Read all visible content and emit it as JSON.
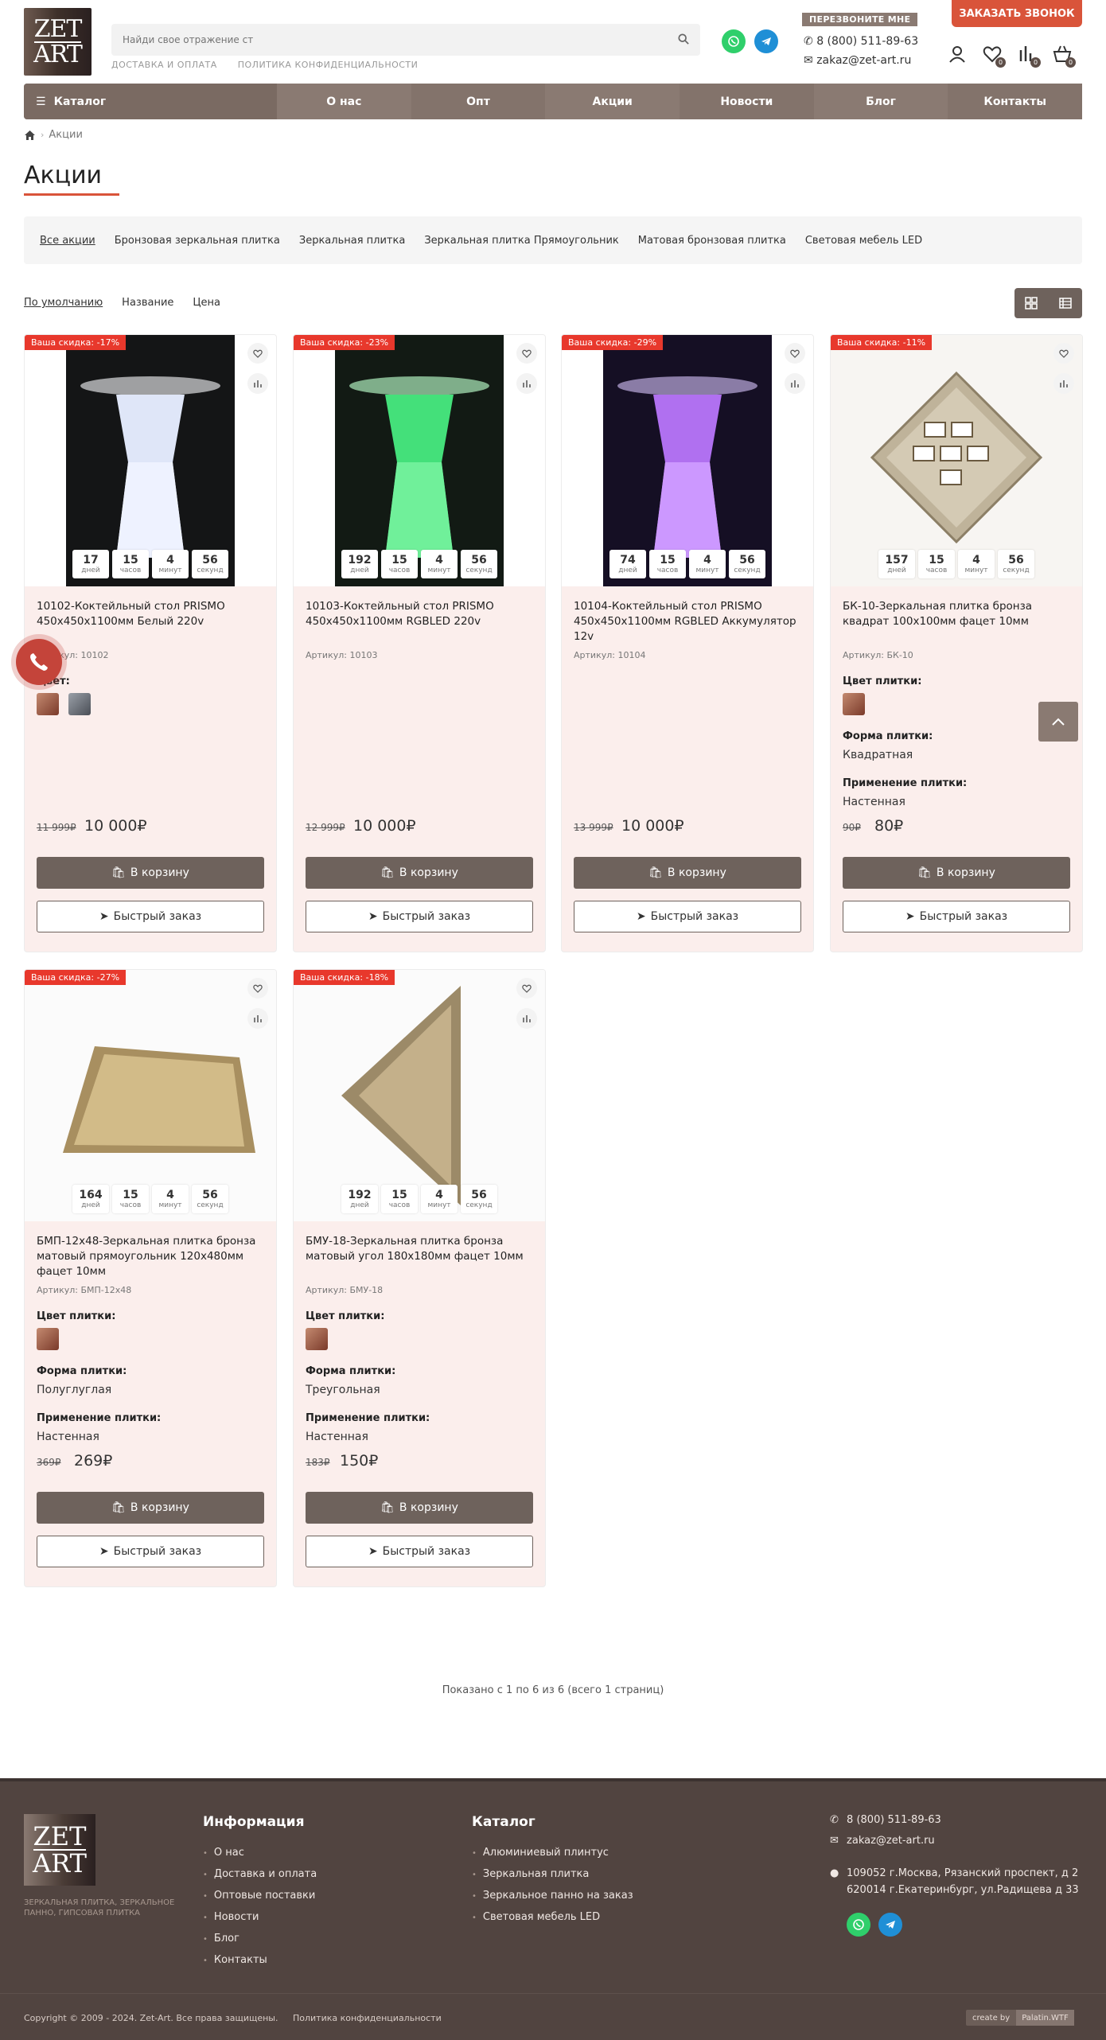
{
  "header": {
    "logo_line1": "ZET",
    "logo_line2": "ART",
    "search_placeholder": "Найди свое отражение ст",
    "links": [
      "ДОСТАВКА И ОПЛАТА",
      "ПОЛИТИКА КОНФИДЕНЦИАЛЬНОСТИ"
    ],
    "callme": "ПЕРЕЗВОНИТЕ МНЕ",
    "phone": "8 (800) 511-89-63",
    "email": "zakaz@zet-art.ru",
    "order_call": "ЗАКАЗАТЬ ЗВОНОК",
    "wishlist_count": "0",
    "compare_count": "0",
    "cart_count": "0"
  },
  "nav": {
    "catalog": "Каталог",
    "items": [
      "О нас",
      "Опт",
      "Акции",
      "Новости",
      "Блог",
      "Контакты"
    ]
  },
  "breadcrumb": {
    "current": "Акции"
  },
  "page_title": "Акции",
  "filters": [
    "Все акции",
    "Бронзовая зеркальная плитка",
    "Зеркальная плитка",
    "Зеркальная плитка Прямоугольник",
    "Матовая бронзовая плитка",
    "Световая мебель LED"
  ],
  "sort": [
    "По умолчанию",
    "Название",
    "Цена"
  ],
  "labels": {
    "days": "дней",
    "hours": "часов",
    "minutes": "минут",
    "seconds": "секунд",
    "sku_prefix": "Артикул:",
    "color": "Цвет:",
    "tile_color": "Цвет плитки:",
    "tile_shape": "Форма плитки:",
    "tile_use": "Применение плитки:",
    "cart": "В корзину",
    "quick": "Быстрый заказ"
  },
  "products": [
    {
      "badge": "Ваша скидка: -17%",
      "name": "10102-Коктейльный стол PRISMO 450х450х1100мм Белый 220v",
      "sku": "10102",
      "days": "17",
      "hours": "15",
      "minutes": "4",
      "seconds": "56",
      "old_price": "11 999₽",
      "price": "10 000₽"
    },
    {
      "badge": "Ваша скидка: -23%",
      "name": "10103-Коктейльный стол PRISMO 450х450х1100мм RGBLED 220v",
      "sku": "10103",
      "days": "192",
      "hours": "15",
      "minutes": "4",
      "seconds": "56",
      "old_price": "12 999₽",
      "price": "10 000₽"
    },
    {
      "badge": "Ваша скидка: -29%",
      "name": "10104-Коктейльный стол PRISMO 450х450х1100мм RGBLED Аккумулятор 12v",
      "sku": "10104",
      "days": "74",
      "hours": "15",
      "minutes": "4",
      "seconds": "56",
      "old_price": "13 999₽",
      "price": "10 000₽"
    },
    {
      "badge": "Ваша скидка: -11%",
      "name": "БК-10-Зеркальная плитка бронза квадрат 100х100мм фацет 10мм",
      "sku": "БК-10",
      "days": "157",
      "hours": "15",
      "minutes": "4",
      "seconds": "56",
      "shape": "Квадратная",
      "use": "Настенная",
      "old_price": "90₽",
      "price": "80₽"
    },
    {
      "badge": "Ваша скидка: -27%",
      "name": "БМП-12х48-Зеркальная плитка бронза матовый прямоугольник 120х480мм фацет 10мм",
      "sku": "БМП-12х48",
      "days": "164",
      "hours": "15",
      "minutes": "4",
      "seconds": "56",
      "shape": "Полуглуглая",
      "use": "Настенная",
      "old_price": "369₽",
      "price": "269₽"
    },
    {
      "badge": "Ваша скидка: -18%",
      "name": "БМУ-18-Зеркальная плитка бронза матовый угол 180х180мм фацет 10мм",
      "sku": "БМУ-18",
      "days": "192",
      "hours": "15",
      "minutes": "4",
      "seconds": "56",
      "shape": "Треугольная",
      "use": "Настенная",
      "old_price": "183₽",
      "price": "150₽"
    }
  ],
  "pagination_info": "Показано с 1 по 6 из 6 (всего 1 страниц)",
  "footer": {
    "tagline": "ЗЕРКАЛЬНАЯ ПЛИТКА, ЗЕРКАЛЬНОЕ ПАННО, ГИПСОВАЯ ПЛИТКА",
    "info_heading": "Информация",
    "info_links": [
      "О нас",
      "Доставка и оплата",
      "Оптовые поставки",
      "Новости",
      "Блог",
      "Контакты"
    ],
    "catalog_heading": "Каталог",
    "catalog_links": [
      "Алюминиевый плинтус",
      "Зеркальная плитка",
      "Зеркальное панно на заказ",
      "Световая мебель LED"
    ],
    "phone": "8 (800) 511-89-63",
    "email": "zakaz@zet-art.ru",
    "address1": "109052 г.Москва, Рязанский проспект, д 2",
    "address2": "620014 г.Екатеринбург, ул.Радищева д 33",
    "copyright": "Copyright © 2009 - 2024. Zet-Art. Все права защищены.",
    "privacy": "Политика конфиденциальности",
    "createby": "create by",
    "studio": "Palatin.WTF"
  },
  "colors": {
    "accent": "#d9543a",
    "nav": "#8a7a72",
    "button": "#6e625c",
    "footer": "#514440",
    "badge": "#e8382c"
  }
}
